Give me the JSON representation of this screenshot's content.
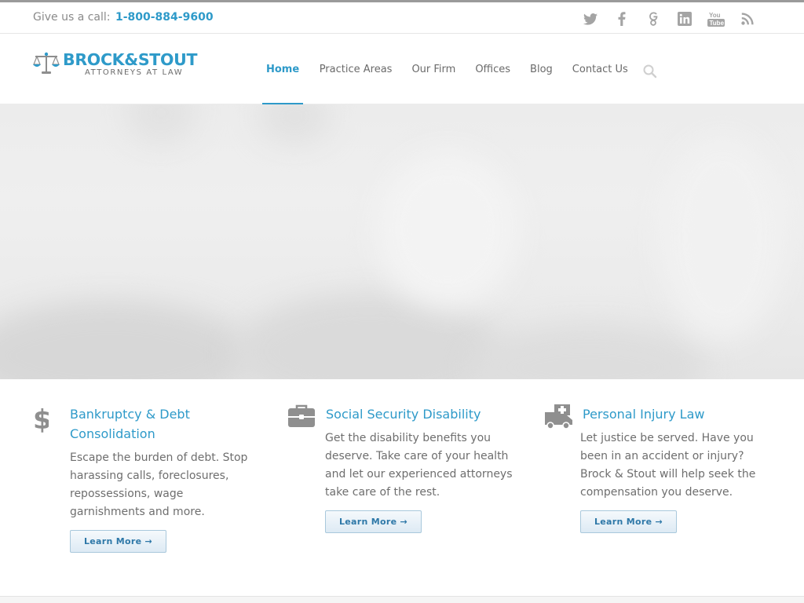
{
  "topbar": {
    "call_label": "Give us a call:",
    "phone": "1-800-884-9600",
    "social_icons": [
      "twitter-icon",
      "facebook-icon",
      "google-plus-icon",
      "linkedin-icon",
      "youtube-icon",
      "rss-icon"
    ]
  },
  "header": {
    "logo_brand": "BROCK&STOUT",
    "logo_tagline": "ATTORNEYS AT LAW",
    "nav": [
      "Home",
      "Practice Areas",
      "Our Firm",
      "Offices",
      "Blog",
      "Contact Us"
    ],
    "active_nav": "Home"
  },
  "features": [
    {
      "icon": "dollar-icon",
      "title": "Bankruptcy & Debt Consolidation",
      "body": "Escape the burden of debt. Stop harassing calls, foreclosures, repossessions, wage garnishments and more.",
      "button": "Learn More →"
    },
    {
      "icon": "briefcase-icon",
      "title": "Social Security Disability",
      "body": " Get the disability benefits you deserve. Take care of your health and let our experienced attorneys take care of the rest.",
      "button": "Learn More →"
    },
    {
      "icon": "ambulance-icon",
      "title": "Personal Injury Law",
      "body": " Let justice be served. Have you been in an accident or injury? Brock & Stout will help seek the compensation you deserve.",
      "button": "Learn More →"
    }
  ],
  "colors": {
    "accent": "#2e9ac9",
    "text": "#6e6e6e",
    "icon_gray": "#8f8f8f"
  }
}
